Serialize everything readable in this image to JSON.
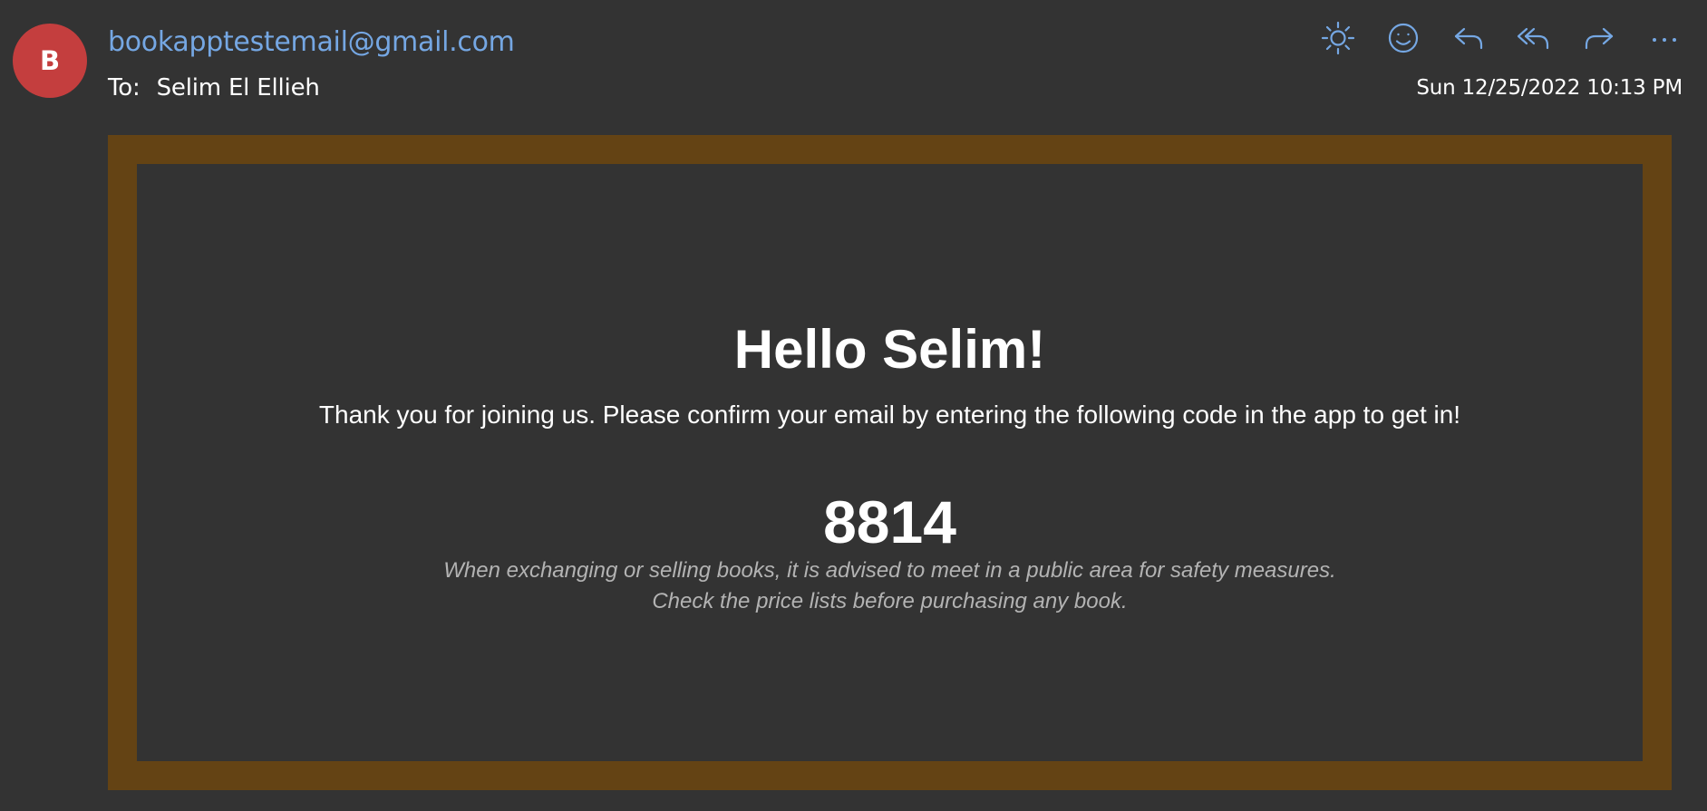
{
  "header": {
    "avatar_initial": "B",
    "avatar_color": "#c43e3e",
    "sender": "bookapptestemail@gmail.com",
    "to_label": "To:",
    "recipient": "Selim El Ellieh",
    "date": "Sun 12/25/2022 10:13 PM",
    "accent_color": "#75a7e3"
  },
  "toolbar": {
    "items": [
      {
        "name": "sun-icon",
        "action": "Switch background"
      },
      {
        "name": "smiley-icon",
        "action": "React"
      },
      {
        "name": "reply-icon",
        "action": "Reply"
      },
      {
        "name": "reply-all-icon",
        "action": "Reply all"
      },
      {
        "name": "forward-icon",
        "action": "Forward"
      },
      {
        "name": "more-icon",
        "action": "More actions"
      }
    ]
  },
  "email": {
    "frame_color": "#644314",
    "greeting": "Hello Selim!",
    "message": "Thank you for joining us. Please confirm your email by entering the following code in the app to get in!",
    "code": "8814",
    "notice_line1": "When exchanging or selling books, it is advised to meet in a public area for safety measures.",
    "notice_line2": "Check the price lists before purchasing any book."
  }
}
